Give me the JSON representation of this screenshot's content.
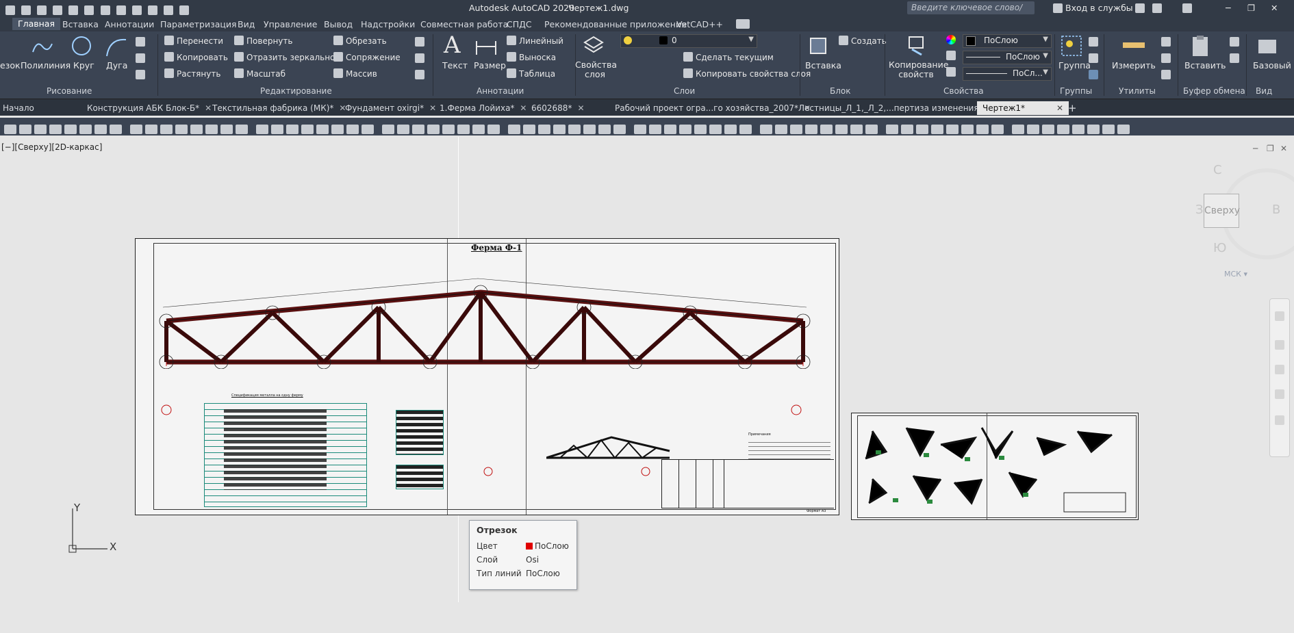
{
  "app": {
    "title": "Autodesk AutoCAD 2020",
    "doc": "Чертеж1.dwg",
    "search_placeholder": "Введите ключевое слово/фразу",
    "signin": "Вход в службы"
  },
  "menu": [
    "Главная",
    "Вставка",
    "Аннотации",
    "Параметризация",
    "Вид",
    "Управление",
    "Вывод",
    "Надстройки",
    "Совместная работа",
    "СПДС",
    "Рекомендованные приложения",
    "VetCAD++"
  ],
  "ribbon": {
    "draw": {
      "items": [
        "езок",
        "Полилиния",
        "Круг",
        "Дуга"
      ],
      "label": "Рисование"
    },
    "modify": {
      "items": [
        "Перенести",
        "Повернуть",
        "Обрезать",
        "Копировать",
        "Отразить зеркально",
        "Сопряжение",
        "Растянуть",
        "Масштаб",
        "Массив"
      ],
      "label": "Редактирование"
    },
    "annot": {
      "items": [
        "Текст",
        "Размер",
        "Линейный",
        "Выноска",
        "Таблица"
      ],
      "label": "Аннотации"
    },
    "layers": {
      "props": "Свойства слоя",
      "current": "0",
      "make_current": "Сделать текущим",
      "copy_props": "Копировать свойства слоя",
      "label": "Слои"
    },
    "block": {
      "insert": "Вставка",
      "create": "Создать",
      "label": "Блок"
    },
    "props": {
      "match": "Копирование свойств",
      "color": "ПоСлою",
      "linetype": "ПоСлою",
      "lineweight": "ПоСл...",
      "label": "Свойства"
    },
    "groups": {
      "group": "Группа",
      "label": "Группы"
    },
    "utils": {
      "measure": "Измерить",
      "label": "Утилиты"
    },
    "clip": {
      "paste": "Вставить",
      "label": "Буфер обмена"
    },
    "view": {
      "base": "Базовый",
      "label": "Вид"
    }
  },
  "file_tabs": [
    "Начало",
    "Конструкция АБК Блок-Б*",
    "Текстильная фабрика (МК)*",
    "Фундамент oxirgi*",
    "1.Ферма Лойиха*",
    "6602688*",
    "Рабочий проект огра...го хозяйства_2007*",
    "Лестницы_Л_1,_Л_2,...пертиза изменения*",
    "Чертеж1*"
  ],
  "viewport": {
    "label": "[−][Сверху][2D-каркас]",
    "cube_top": "Сверху",
    "north": "С",
    "south": "Ю",
    "west": "З",
    "east": "В",
    "ucs": "МСК",
    "axis_x": "X",
    "axis_y": "Y"
  },
  "drawing": {
    "title": "Ферма Ф-1",
    "spec_title": "Спецификация металла на одну ферму",
    "notes_title": "Примечания",
    "format": "Формат А3"
  },
  "tooltip": {
    "title": "Отрезок",
    "rows": [
      {
        "k": "Цвет",
        "v": "ПоСлою"
      },
      {
        "k": "Слой",
        "v": "Osi"
      },
      {
        "k": "Тип линий",
        "v": "ПоСлою"
      }
    ]
  }
}
